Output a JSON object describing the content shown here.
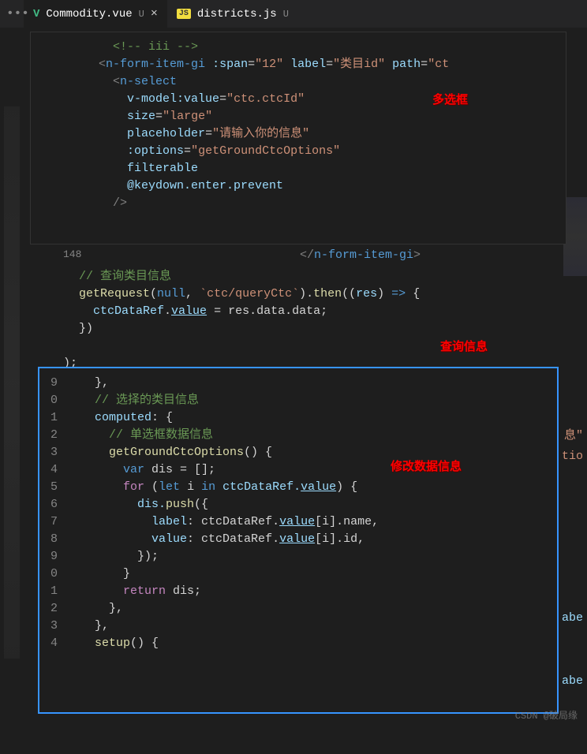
{
  "tabs": {
    "tab1": {
      "icon": "V",
      "name": "Commodity.vue",
      "status": "U"
    },
    "tab2": {
      "icon": "JS",
      "name": "districts.js",
      "status": "U"
    }
  },
  "annotations": {
    "multi_select": "多选框",
    "query_info": "查询信息",
    "modify_data": "修改数据信息"
  },
  "snippet1_lines": {
    "l0": "<!-- iii -->",
    "l1_open": "<",
    "l1_tag": "n-form-item-gi",
    "l1_attr1": " :span",
    "l1_eq": "=",
    "l1_val1": "\"12\"",
    "l1_attr2": " label",
    "l1_val2": "\"类目id\"",
    "l1_attr3": " path",
    "l1_val3": "\"ct",
    "l2_open": "<",
    "l2_tag": "n-select",
    "l3_attr": "v-model:value",
    "l3_val": "\"ctc.ctcId\"",
    "l4_attr": "size",
    "l4_val": "\"large\"",
    "l5_attr": "placeholder",
    "l5_val": "\"请输入你的信息\"",
    "l6_attr": ":options",
    "l6_val": "\"getGroundCtcOptions\"",
    "l7": "filterable",
    "l8_attr": "@keydown.enter.prevent",
    "l9": "/>"
  },
  "main_lines": {
    "ln148": "148",
    "close_hint": "</n-form-item-gi>",
    "c1": "// 查询类目信息",
    "c2a": "getRequest",
    "c2b": "null",
    "c2c": "`ctc/queryCtc`",
    "c2d": "then",
    "c2e": "res",
    "c3a": "ctcDataRef",
    "c3b": "value",
    "c3c": " = res.data.data;"
  },
  "snippet2": {
    "nums": [
      "9",
      "0",
      "1",
      "2",
      "3",
      "4",
      "5",
      "6",
      "7",
      "8",
      "9",
      "0",
      "1",
      "2",
      "3",
      "4"
    ],
    "l1": "},",
    "l2": "// 选择的类目信息",
    "l3a": "computed",
    "l3b": ": {",
    "l4": "// 单选框数据信息",
    "l5a": "getGroundCtcOptions",
    "l5b": "() {",
    "l6a": "var",
    "l6b": " dis = [];",
    "l7a": "for",
    "l7b": "let",
    "l7c": " i ",
    "l7d": "in",
    "l7e": " ctcDataRef.",
    "l7f": "value",
    "l7g": ") {",
    "l8": "dis.",
    "l8b": "push",
    "l8c": "({",
    "l9a": "label",
    "l9b": ": ctcDataRef.",
    "l9c": "value",
    "l9d": "[i].name,",
    "l10a": "value",
    "l10b": ": ctcDataRef.",
    "l10c": "value",
    "l10d": "[i].id,",
    "l11": "});",
    "l12": "}",
    "l13a": "return",
    "l13b": " dis;",
    "l14": "},",
    "l15": "},",
    "l16a": "setup",
    "l16b": "() {"
  },
  "peek": {
    "p1": "息\"",
    "p2": "tio",
    "p3": "abe",
    "p4": "abe"
  },
  "watermark": "CSDN @破局缘"
}
